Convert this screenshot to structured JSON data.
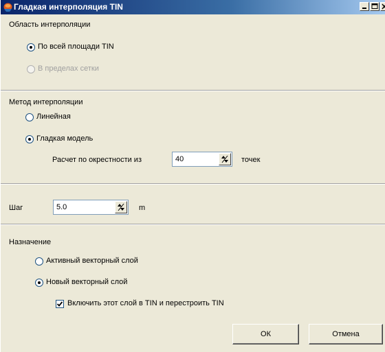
{
  "window": {
    "title": "Гладкая интерполяция TIN",
    "icon": "app-icon",
    "controls": [
      "minimize-icon",
      "maximize-icon",
      "close-icon"
    ]
  },
  "area": {
    "label": "Область интерполяции",
    "options": [
      {
        "label": "По всей площади TIN",
        "selected": true,
        "enabled": true
      },
      {
        "label": "В пределах сетки",
        "selected": false,
        "enabled": false
      }
    ]
  },
  "method": {
    "label": "Метод интерполяции",
    "options": [
      {
        "label": "Линейная",
        "selected": false
      },
      {
        "label": "Гладкая модель",
        "selected": true
      }
    ],
    "neighborhood_label": "Расчет по окрестности из",
    "neighborhood_value": "40",
    "neighborhood_unit": "точек"
  },
  "step": {
    "label": "Шаг",
    "value": "5.0",
    "unit": "m"
  },
  "destination": {
    "label": "Назначение",
    "options": [
      {
        "label": "Активный векторный слой",
        "selected": false
      },
      {
        "label": "Новый векторный слой",
        "selected": true
      }
    ],
    "include_checkbox": {
      "label": "Включить этот слой в TIN и перестроить TIN",
      "checked": true
    }
  },
  "buttons": {
    "ok": "ОК",
    "cancel": "Отмена"
  }
}
